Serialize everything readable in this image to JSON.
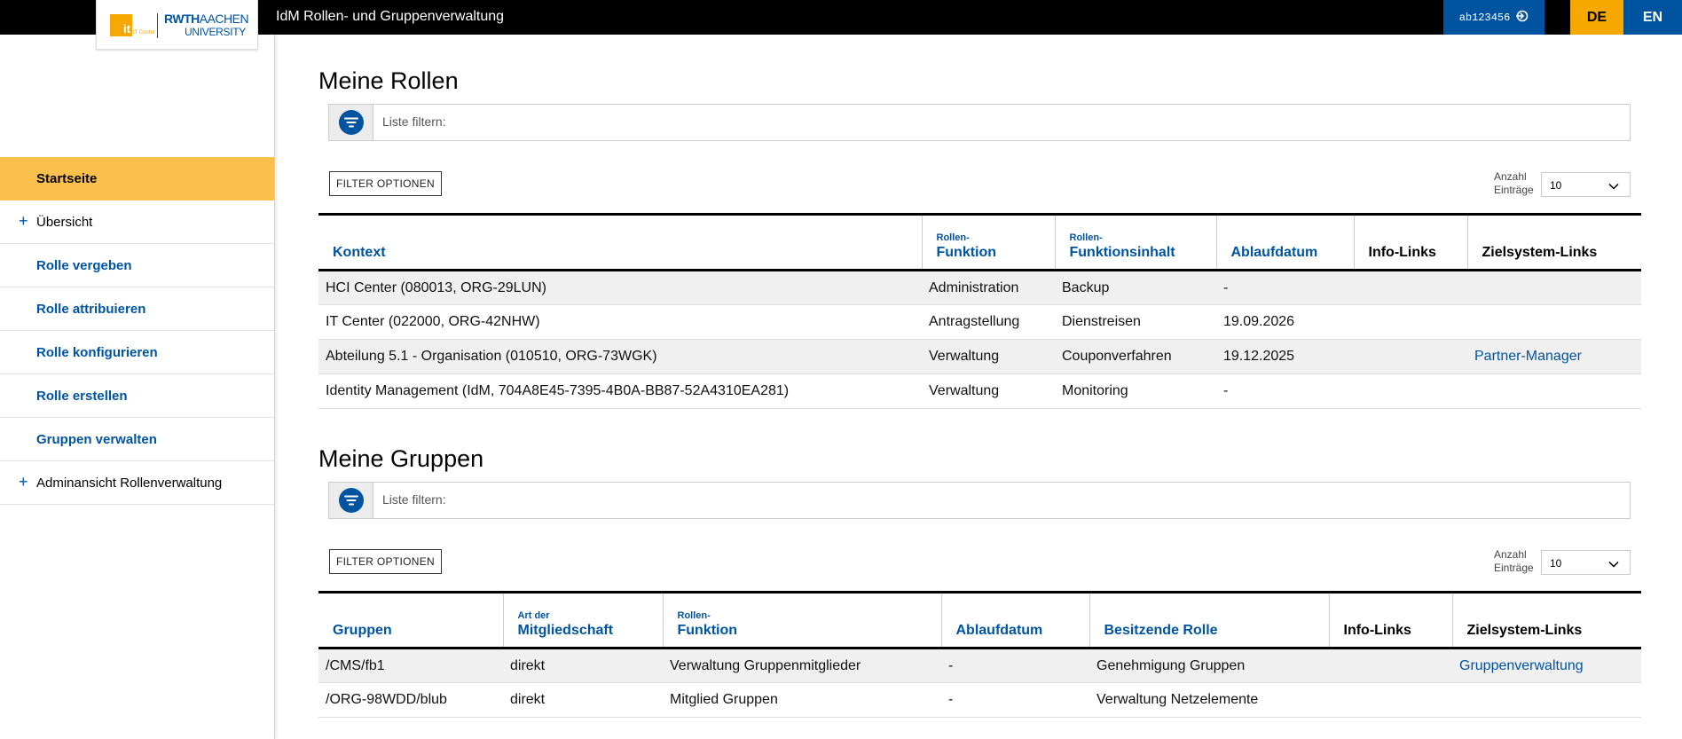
{
  "header": {
    "app_title": "IdM Rollen- und Gruppenverwaltung",
    "user": "ab123456",
    "lang_de": "DE",
    "lang_en": "EN",
    "logo": {
      "it": "it",
      "it_sub": "IT Center",
      "rwth": "RWTH",
      "aachen": "AACHEN",
      "university": "UNIVERSITY"
    }
  },
  "sidebar": {
    "items": [
      {
        "label": "Startseite"
      },
      {
        "label": "Übersicht"
      },
      {
        "label": "Rolle vergeben"
      },
      {
        "label": "Rolle attribuieren"
      },
      {
        "label": "Rolle konfigurieren"
      },
      {
        "label": "Rolle erstellen"
      },
      {
        "label": "Gruppen verwalten"
      },
      {
        "label": "Adminansicht Rollenverwaltung"
      }
    ]
  },
  "roles": {
    "title": "Meine Rollen",
    "filter_placeholder": "Liste filtern:",
    "options_label": "FILTER OPTIONEN",
    "count_label_1": "Anzahl",
    "count_label_2": "Einträge",
    "count_value": "10",
    "columns": {
      "kontext": "Kontext",
      "funktion_small": "Rollen-",
      "funktion": "Funktion",
      "inhalt_small": "Rollen-",
      "inhalt": "Funktionsinhalt",
      "ablauf": "Ablaufdatum",
      "info": "Info-Links",
      "ziel": "Zielsystem-Links"
    },
    "rows": [
      {
        "kontext": "HCI Center (080013, ORG-29LUN)",
        "funktion": "Administration",
        "inhalt": "Backup",
        "ablauf": "-",
        "info": "",
        "ziel": ""
      },
      {
        "kontext": "IT Center (022000, ORG-42NHW)",
        "funktion": "Antragstellung",
        "inhalt": "Dienstreisen",
        "ablauf": "19.09.2026",
        "info": "",
        "ziel": ""
      },
      {
        "kontext": "Abteilung 5.1 - Organisation (010510, ORG-73WGK)",
        "funktion": "Verwaltung",
        "inhalt": "Couponverfahren",
        "ablauf": "19.12.2025",
        "info": "",
        "ziel": "Partner-Manager"
      },
      {
        "kontext": "Identity Management (IdM, 704A8E45-7395-4B0A-BB87-52A4310EA281)",
        "funktion": "Verwaltung",
        "inhalt": "Monitoring",
        "ablauf": "-",
        "info": "",
        "ziel": ""
      }
    ]
  },
  "groups": {
    "title": "Meine Gruppen",
    "filter_placeholder": "Liste filtern:",
    "options_label": "FILTER OPTIONEN",
    "count_label_1": "Anzahl",
    "count_label_2": "Einträge",
    "count_value": "10",
    "columns": {
      "gruppen": "Gruppen",
      "art_small": "Art der",
      "art": "Mitgliedschaft",
      "funktion_small": "Rollen-",
      "funktion": "Funktion",
      "ablauf": "Ablaufdatum",
      "besitz": "Besitzende Rolle",
      "info": "Info-Links",
      "ziel": "Zielsystem-Links"
    },
    "rows": [
      {
        "gruppe": "/CMS/fb1",
        "art": "direkt",
        "funktion": "Verwaltung Gruppenmitglieder",
        "ablauf": "-",
        "besitz": "Genehmigung Gruppen",
        "info": "",
        "ziel": "Gruppenverwaltung"
      },
      {
        "gruppe": "/ORG-98WDD/blub",
        "art": "direkt",
        "funktion": "Mitglied Gruppen",
        "ablauf": "-",
        "besitz": "Verwaltung Netzelemente",
        "info": "",
        "ziel": ""
      }
    ]
  }
}
